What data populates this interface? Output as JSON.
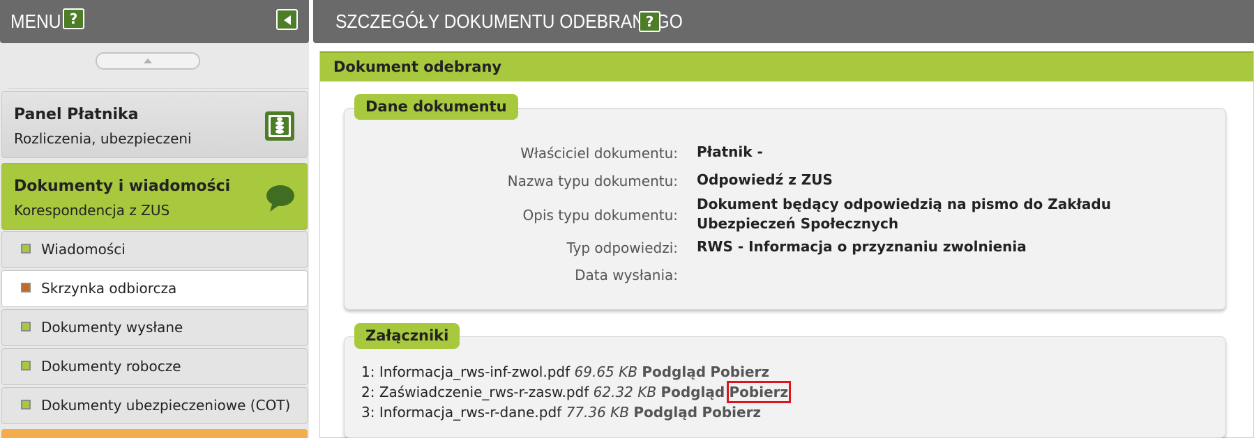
{
  "sidebar": {
    "title": "MENU",
    "help_label": "?",
    "panels": [
      {
        "title": "Panel Płatnika",
        "subtitle": "Rozliczenia, ubezpieczeni",
        "icon": "stack-icon"
      },
      {
        "title": "Dokumenty i wiadomości",
        "subtitle": "Korespondencja z ZUS",
        "icon": "speech-bubble-icon"
      }
    ],
    "items": [
      {
        "label": "Wiadomości"
      },
      {
        "label": "Skrzynka odbiorcza"
      },
      {
        "label": "Dokumenty wysłane"
      },
      {
        "label": "Dokumenty robocze"
      },
      {
        "label": "Dokumenty ubezpieczeniowe (COT)"
      }
    ],
    "active_item": "Skrzynka odbiorcza"
  },
  "main": {
    "title": "SZCZEGÓŁY DOKUMENTU ODEBRANEGO",
    "help_label": "?",
    "card_title": "Dokument odebrany",
    "details": {
      "heading": "Dane dokumentu",
      "fields": [
        {
          "label": "Właściciel dokumentu:",
          "value": "Płatnik -"
        },
        {
          "label": "Nazwa typu dokumentu:",
          "value": "Odpowiedź z ZUS"
        },
        {
          "label": "Opis typu dokumentu:",
          "value": "Dokument będący odpowiedzią na pismo do Zakładu Ubezpieczeń Społecznych"
        },
        {
          "label": "Typ odpowiedzi:",
          "value": "RWS - Informacja o przyznaniu zwolnienia"
        },
        {
          "label": "Data wysłania:",
          "value": ""
        }
      ]
    },
    "attachments": {
      "heading": "Załączniki",
      "items": [
        {
          "index": "1:",
          "filename": "Informacja_rws-inf-zwol.pdf",
          "size": "69.65 KB",
          "preview": "Podgląd",
          "download": "Pobierz"
        },
        {
          "index": "2:",
          "filename": "Zaświadczenie_rws-r-zasw.pdf",
          "size": "62.32 KB",
          "preview": "Podgląd",
          "download": "Pobierz"
        },
        {
          "index": "3:",
          "filename": "Informacja_rws-r-dane.pdf",
          "size": "77.36 KB",
          "preview": "Podgląd",
          "download": "Pobierz"
        }
      ]
    }
  },
  "colors": {
    "header_gray": "#6a6a6a",
    "accent_green": "#a8c93e",
    "help_green": "#4e7d28",
    "highlight_red": "#e0141c",
    "active_bullet": "#c06a2a",
    "orange_panel": "#f3ad4b"
  }
}
